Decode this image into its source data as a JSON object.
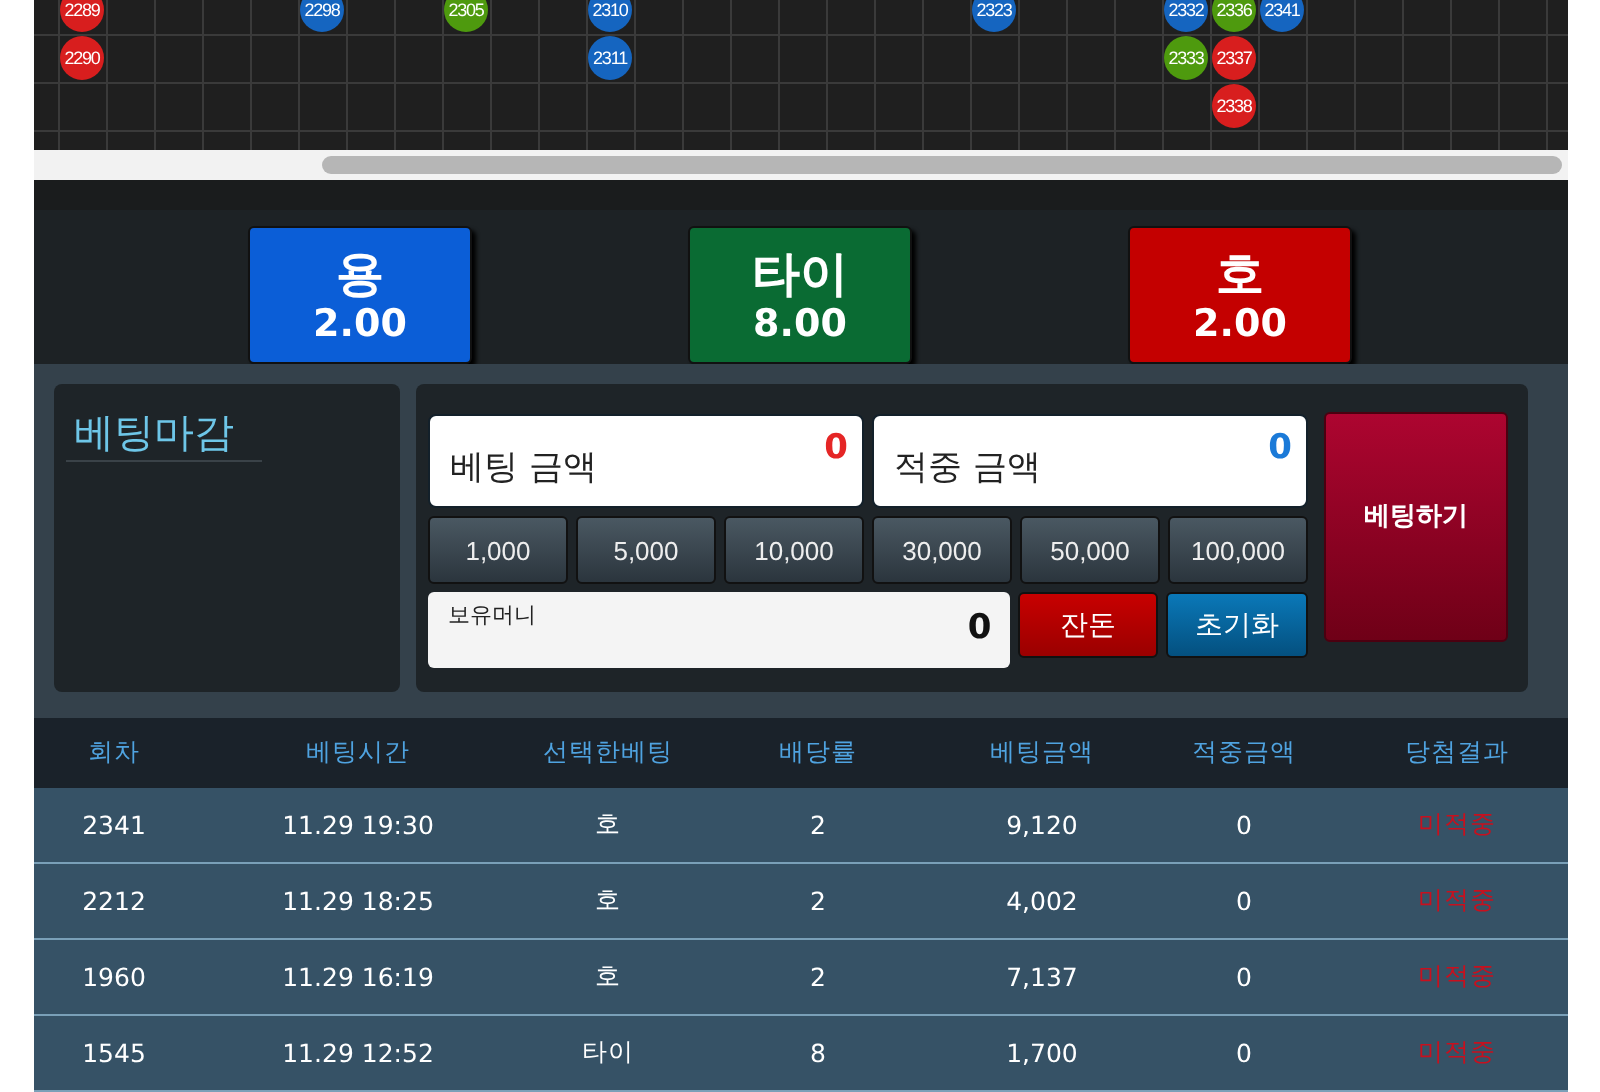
{
  "bead_road": {
    "beads": [
      {
        "label": "2289",
        "color": "#d81e1e"
      },
      {
        "label": "2290",
        "color": "#d81e1e"
      },
      {
        "label": "2298",
        "color": "#1565c0"
      },
      {
        "label": "2305",
        "color": "#4e9a0e"
      },
      {
        "label": "2310",
        "color": "#1565c0"
      },
      {
        "label": "2311",
        "color": "#1565c0"
      },
      {
        "label": "2323",
        "color": "#1565c0"
      },
      {
        "label": "2332",
        "color": "#1565c0"
      },
      {
        "label": "2333",
        "color": "#4e9a0e"
      },
      {
        "label": "2336",
        "color": "#4e9a0e"
      },
      {
        "label": "2337",
        "color": "#d81e1e"
      },
      {
        "label": "2338",
        "color": "#d81e1e"
      },
      {
        "label": "2341",
        "color": "#1565c0"
      }
    ]
  },
  "bet_options": [
    {
      "name": "용",
      "odds": "2.00",
      "color": "#0b5ed7"
    },
    {
      "name": "타이",
      "odds": "8.00",
      "color": "#0a6b33"
    },
    {
      "name": "호",
      "odds": "2.00",
      "color": "#c40000"
    }
  ],
  "status_title": "베팅마감",
  "bet_amount": {
    "label": "베팅 금액",
    "value": "0"
  },
  "win_amount": {
    "label": "적중 금액",
    "value": "0"
  },
  "chips": [
    "1,000",
    "5,000",
    "10,000",
    "30,000",
    "50,000",
    "100,000"
  ],
  "balance": {
    "label": "보유머니",
    "value": "0"
  },
  "change_button": "잔돈",
  "reset_button": "초기화",
  "bet_button": "베팅하기",
  "history": {
    "columns": [
      "회차",
      "베팅시간",
      "선택한베팅",
      "배당률",
      "베팅금액",
      "적중금액",
      "당첨결과"
    ],
    "rows": [
      [
        "2341",
        "11.29 19:30",
        "호",
        "2",
        "9,120",
        "0",
        "미적중"
      ],
      [
        "2212",
        "11.29 18:25",
        "호",
        "2",
        "4,002",
        "0",
        "미적중"
      ],
      [
        "1960",
        "11.29 16:19",
        "호",
        "2",
        "7,137",
        "0",
        "미적중"
      ],
      [
        "1545",
        "11.29 12:52",
        "타이",
        "8",
        "1,700",
        "0",
        "미적중"
      ]
    ]
  }
}
